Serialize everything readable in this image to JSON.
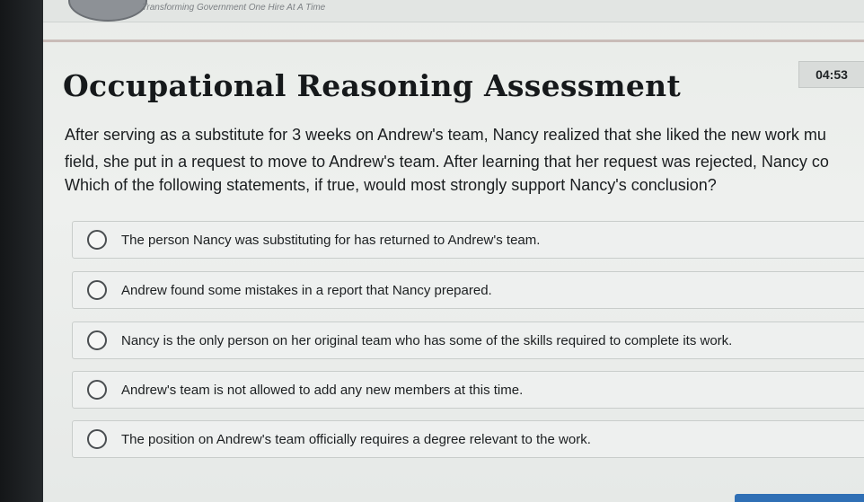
{
  "header": {
    "tagline": "Transforming Government One Hire At A Time"
  },
  "timer": {
    "value": "04:53"
  },
  "assessment": {
    "title": "Occupational Reasoning Assessment",
    "passage_line1": "After serving as a substitute for 3 weeks on Andrew's team, Nancy realized that she liked the new work mu",
    "passage_line2": "field, she put in a request to move to Andrew's team. After learning that her request was rejected, Nancy co",
    "question": "Which of the following statements, if true, would most strongly support Nancy's conclusion?",
    "options": [
      {
        "label": "The person Nancy was substituting for has returned to Andrew's team."
      },
      {
        "label": "Andrew found some mistakes in a report that Nancy prepared."
      },
      {
        "label": "Nancy is the only person on her original team who has some of the skills required to complete its work."
      },
      {
        "label": "Andrew's team is not allowed to add any new members at this time."
      },
      {
        "label": "The position on Andrew's team officially requires a degree relevant to the work."
      }
    ]
  }
}
